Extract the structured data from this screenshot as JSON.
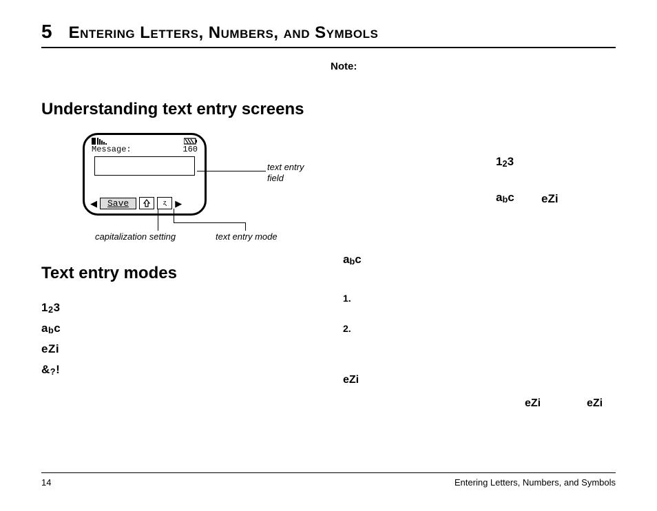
{
  "chapter": {
    "number": "5",
    "title": "Entering Letters, Numbers, and Symbols"
  },
  "note_label": "Note:",
  "left": {
    "h_understanding": "Understanding text entry screens",
    "h_modes": "Text entry modes",
    "phone": {
      "msg_label": "Message:",
      "counter": "160",
      "save": "Save"
    },
    "callouts": {
      "field": "text entry field",
      "cap": "capitalization setting",
      "mode": "text entry mode"
    },
    "modes": {
      "m123": "123",
      "mabc": "abc",
      "mezi": "eZi",
      "msym": "&?!"
    }
  },
  "right": {
    "tok_123": "123",
    "tok_abc_a": "abc",
    "tok_ezi_a": "eZi",
    "tok_abc_b": "abc",
    "step1": "1.",
    "step2": "2.",
    "tok_ezi_b": "eZi",
    "tok_ezi_c": "eZi",
    "tok_ezi_d": "eZi"
  },
  "footer": {
    "page": "14",
    "running": "Entering Letters, Numbers, and Symbols"
  }
}
